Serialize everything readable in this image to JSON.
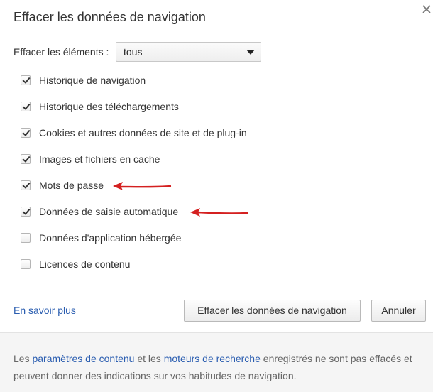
{
  "dialog": {
    "title": "Effacer les données de navigation",
    "close_icon": "close-icon"
  },
  "time_range": {
    "label": "Effacer les éléments :",
    "selected": "tous"
  },
  "options": [
    {
      "label": "Historique de navigation",
      "checked": true
    },
    {
      "label": "Historique des téléchargements",
      "checked": true
    },
    {
      "label": "Cookies et autres données de site et de plug-in",
      "checked": true
    },
    {
      "label": "Images et fichiers en cache",
      "checked": true
    },
    {
      "label": "Mots de passe",
      "checked": true
    },
    {
      "label": "Données de saisie automatique",
      "checked": true
    },
    {
      "label": "Données d'application hébergée",
      "checked": false
    },
    {
      "label": "Licences de contenu",
      "checked": false
    }
  ],
  "annotations": {
    "arrow_color": "#d42020"
  },
  "actions": {
    "learn_more": "En savoir plus",
    "clear_button": "Effacer les données de navigation",
    "cancel_button": "Annuler"
  },
  "footer": {
    "text_before": "Les ",
    "link1": "paramètres de contenu",
    "text_middle": " et les ",
    "link2": "moteurs de recherche",
    "text_after": " enregistrés ne sont pas effacés et peuvent donner des indications sur vos habitudes de navigation."
  }
}
